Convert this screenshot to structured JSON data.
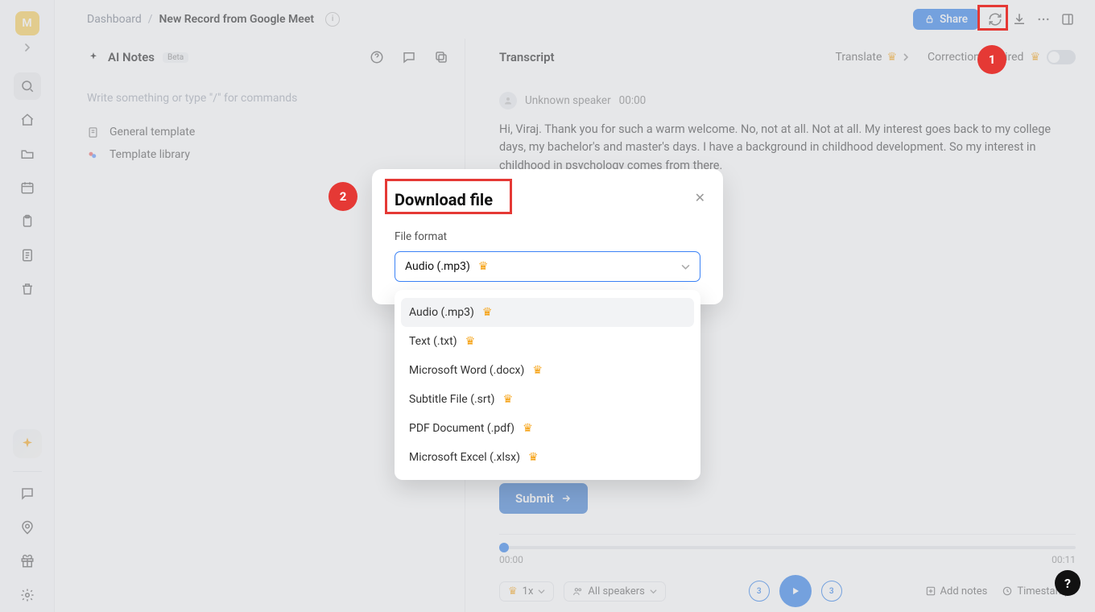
{
  "rail": {
    "avatar_letter": "M"
  },
  "breadcrumb": {
    "root": "Dashboard",
    "separator": "/",
    "title": "New Record from Google Meet"
  },
  "topbar": {
    "share_label": "Share"
  },
  "ai_notes": {
    "title": "AI Notes",
    "badge": "Beta",
    "placeholder": "Write something or type \"/\" for commands",
    "template_items": [
      {
        "label": "General template"
      },
      {
        "label": "Template library"
      }
    ]
  },
  "transcript": {
    "title": "Transcript",
    "translate_label": "Translate",
    "correction_label": "Correction required",
    "speaker_name": "Unknown speaker",
    "speaker_time": "00:00",
    "speech_text": "Hi, Viraj. Thank you for such a warm welcome. No, not at all. Not at all. My interest goes back to my college days, my bachelor's and master's days. I have a background in childhood development. So my interest in childhood in psychology comes from there.",
    "submit_label": "Submit"
  },
  "player": {
    "time_start": "00:00",
    "time_end": "00:11",
    "speed_label": "1x",
    "speakers_label": "All speakers",
    "skip_val": "3",
    "add_notes_label": "Add notes",
    "timestamps_label": "Timestamps"
  },
  "modal": {
    "title": "Download file",
    "file_format_label": "File format",
    "selected_value": "Audio (.mp3)",
    "options": [
      "Audio (.mp3)",
      "Text (.txt)",
      "Microsoft Word (.docx)",
      "Subtitle File (.srt)",
      "PDF Document (.pdf)",
      "Microsoft Excel (.xlsx)"
    ]
  },
  "callouts": {
    "c1": "1",
    "c2": "2"
  },
  "help_fab": "?"
}
